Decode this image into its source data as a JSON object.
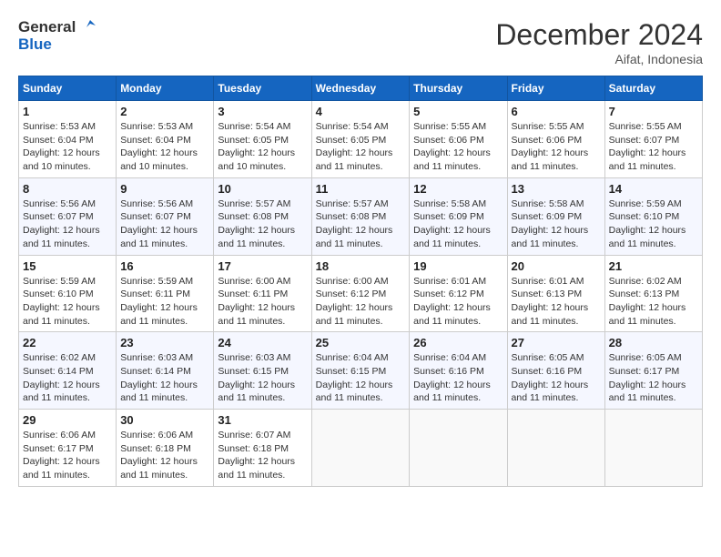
{
  "logo": {
    "line1": "General",
    "line2": "Blue"
  },
  "title": "December 2024",
  "location": "Aifat, Indonesia",
  "weekdays": [
    "Sunday",
    "Monday",
    "Tuesday",
    "Wednesday",
    "Thursday",
    "Friday",
    "Saturday"
  ],
  "weeks": [
    [
      {
        "day": "1",
        "info": "Sunrise: 5:53 AM\nSunset: 6:04 PM\nDaylight: 12 hours\nand 10 minutes."
      },
      {
        "day": "2",
        "info": "Sunrise: 5:53 AM\nSunset: 6:04 PM\nDaylight: 12 hours\nand 10 minutes."
      },
      {
        "day": "3",
        "info": "Sunrise: 5:54 AM\nSunset: 6:05 PM\nDaylight: 12 hours\nand 10 minutes."
      },
      {
        "day": "4",
        "info": "Sunrise: 5:54 AM\nSunset: 6:05 PM\nDaylight: 12 hours\nand 11 minutes."
      },
      {
        "day": "5",
        "info": "Sunrise: 5:55 AM\nSunset: 6:06 PM\nDaylight: 12 hours\nand 11 minutes."
      },
      {
        "day": "6",
        "info": "Sunrise: 5:55 AM\nSunset: 6:06 PM\nDaylight: 12 hours\nand 11 minutes."
      },
      {
        "day": "7",
        "info": "Sunrise: 5:55 AM\nSunset: 6:07 PM\nDaylight: 12 hours\nand 11 minutes."
      }
    ],
    [
      {
        "day": "8",
        "info": "Sunrise: 5:56 AM\nSunset: 6:07 PM\nDaylight: 12 hours\nand 11 minutes."
      },
      {
        "day": "9",
        "info": "Sunrise: 5:56 AM\nSunset: 6:07 PM\nDaylight: 12 hours\nand 11 minutes."
      },
      {
        "day": "10",
        "info": "Sunrise: 5:57 AM\nSunset: 6:08 PM\nDaylight: 12 hours\nand 11 minutes."
      },
      {
        "day": "11",
        "info": "Sunrise: 5:57 AM\nSunset: 6:08 PM\nDaylight: 12 hours\nand 11 minutes."
      },
      {
        "day": "12",
        "info": "Sunrise: 5:58 AM\nSunset: 6:09 PM\nDaylight: 12 hours\nand 11 minutes."
      },
      {
        "day": "13",
        "info": "Sunrise: 5:58 AM\nSunset: 6:09 PM\nDaylight: 12 hours\nand 11 minutes."
      },
      {
        "day": "14",
        "info": "Sunrise: 5:59 AM\nSunset: 6:10 PM\nDaylight: 12 hours\nand 11 minutes."
      }
    ],
    [
      {
        "day": "15",
        "info": "Sunrise: 5:59 AM\nSunset: 6:10 PM\nDaylight: 12 hours\nand 11 minutes."
      },
      {
        "day": "16",
        "info": "Sunrise: 5:59 AM\nSunset: 6:11 PM\nDaylight: 12 hours\nand 11 minutes."
      },
      {
        "day": "17",
        "info": "Sunrise: 6:00 AM\nSunset: 6:11 PM\nDaylight: 12 hours\nand 11 minutes."
      },
      {
        "day": "18",
        "info": "Sunrise: 6:00 AM\nSunset: 6:12 PM\nDaylight: 12 hours\nand 11 minutes."
      },
      {
        "day": "19",
        "info": "Sunrise: 6:01 AM\nSunset: 6:12 PM\nDaylight: 12 hours\nand 11 minutes."
      },
      {
        "day": "20",
        "info": "Sunrise: 6:01 AM\nSunset: 6:13 PM\nDaylight: 12 hours\nand 11 minutes."
      },
      {
        "day": "21",
        "info": "Sunrise: 6:02 AM\nSunset: 6:13 PM\nDaylight: 12 hours\nand 11 minutes."
      }
    ],
    [
      {
        "day": "22",
        "info": "Sunrise: 6:02 AM\nSunset: 6:14 PM\nDaylight: 12 hours\nand 11 minutes."
      },
      {
        "day": "23",
        "info": "Sunrise: 6:03 AM\nSunset: 6:14 PM\nDaylight: 12 hours\nand 11 minutes."
      },
      {
        "day": "24",
        "info": "Sunrise: 6:03 AM\nSunset: 6:15 PM\nDaylight: 12 hours\nand 11 minutes."
      },
      {
        "day": "25",
        "info": "Sunrise: 6:04 AM\nSunset: 6:15 PM\nDaylight: 12 hours\nand 11 minutes."
      },
      {
        "day": "26",
        "info": "Sunrise: 6:04 AM\nSunset: 6:16 PM\nDaylight: 12 hours\nand 11 minutes."
      },
      {
        "day": "27",
        "info": "Sunrise: 6:05 AM\nSunset: 6:16 PM\nDaylight: 12 hours\nand 11 minutes."
      },
      {
        "day": "28",
        "info": "Sunrise: 6:05 AM\nSunset: 6:17 PM\nDaylight: 12 hours\nand 11 minutes."
      }
    ],
    [
      {
        "day": "29",
        "info": "Sunrise: 6:06 AM\nSunset: 6:17 PM\nDaylight: 12 hours\nand 11 minutes."
      },
      {
        "day": "30",
        "info": "Sunrise: 6:06 AM\nSunset: 6:18 PM\nDaylight: 12 hours\nand 11 minutes."
      },
      {
        "day": "31",
        "info": "Sunrise: 6:07 AM\nSunset: 6:18 PM\nDaylight: 12 hours\nand 11 minutes."
      },
      {
        "day": "",
        "info": ""
      },
      {
        "day": "",
        "info": ""
      },
      {
        "day": "",
        "info": ""
      },
      {
        "day": "",
        "info": ""
      }
    ]
  ]
}
